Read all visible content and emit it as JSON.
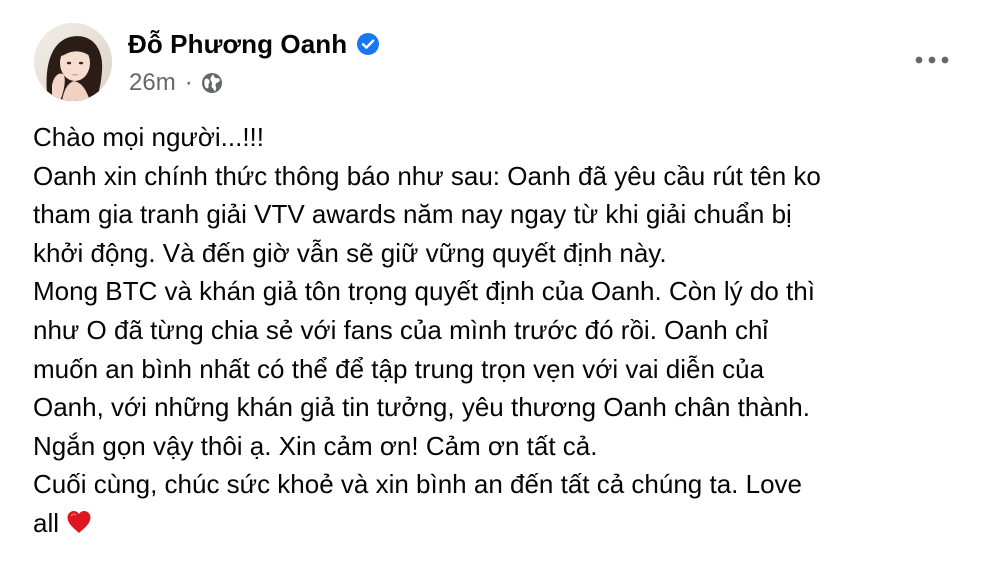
{
  "post": {
    "author": {
      "name": "Đỗ Phương Oanh",
      "verified": true,
      "verified_icon": "verified-badge-icon",
      "avatar_icon": "avatar"
    },
    "meta": {
      "time": "26m",
      "separator": "·",
      "privacy_icon": "globe-icon"
    },
    "more_icon": "more-options-icon",
    "accent_color": "#1877f2",
    "text_color": "#050505",
    "secondary_color": "#65676b",
    "lines": [
      "Chào mọi người...!!!",
      "Oanh xin chính thức thông báo như sau: Oanh đã yêu cầu rút tên ko",
      "tham gia tranh giải VTV awards năm nay ngay từ khi giải chuẩn bị",
      "khởi động. Và đến giờ vẫn sẽ giữ vững quyết định này.",
      "Mong BTC và khán giả tôn trọng quyết định của Oanh. Còn lý do thì",
      "như O đã từng chia sẻ với fans của mình trước đó rồi. Oanh chỉ",
      "muốn an bình nhất có thể để tập trung trọn vẹn với vai diễn của",
      "Oanh, với những khán giả tin tưởng, yêu thương Oanh chân thành.",
      "Ngắn gọn vậy thôi ạ. Xin cảm ơn! Cảm ơn tất cả.",
      "Cuối cùng, chúc sức khoẻ và xin bình an đến tất cả chúng ta. Love",
      "all"
    ],
    "end_emoji_icon": "red-heart-icon"
  }
}
